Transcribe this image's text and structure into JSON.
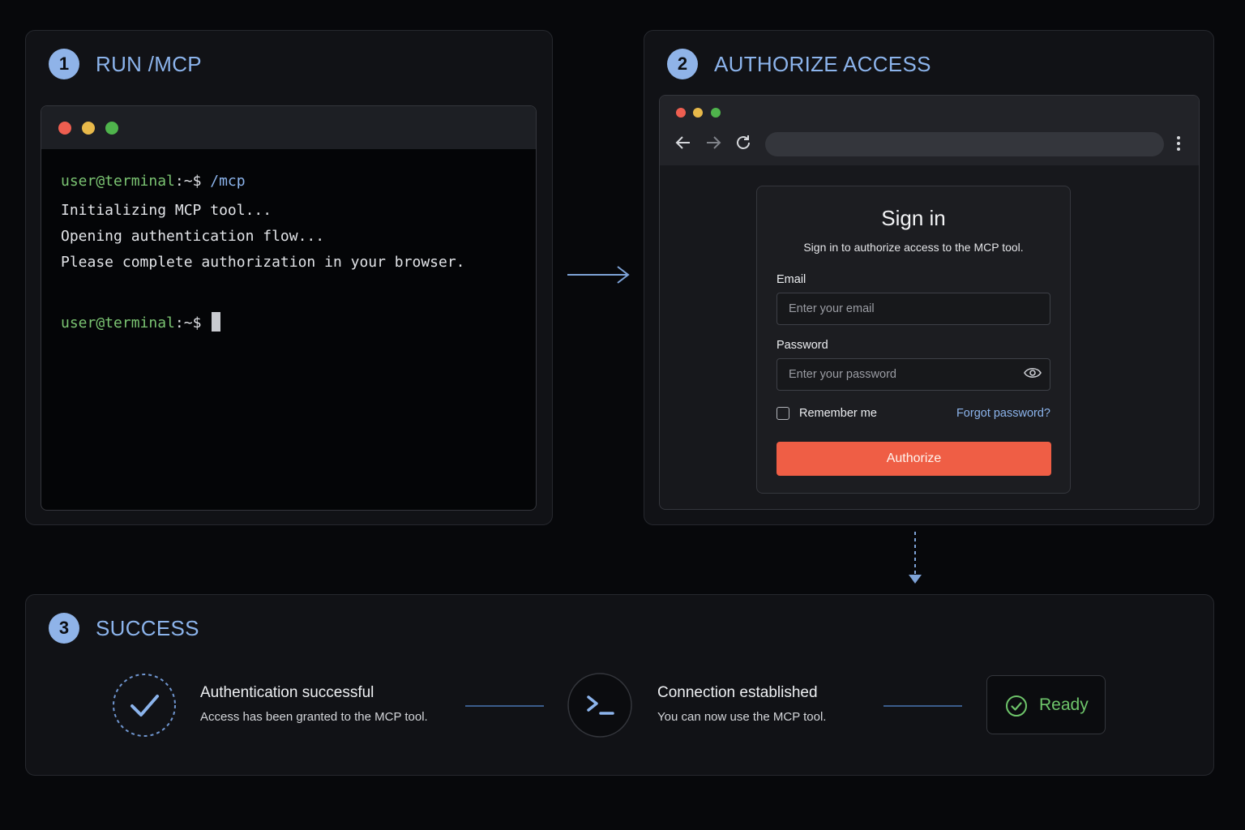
{
  "steps": {
    "run": {
      "number": "1",
      "title": "RUN /MCP"
    },
    "authorize": {
      "number": "2",
      "title": "AUTHORIZE ACCESS"
    },
    "success": {
      "number": "3",
      "title": "SUCCESS"
    }
  },
  "terminal": {
    "prompt_user": "user@terminal",
    "prompt_path": ":~$",
    "command": "/mcp",
    "output": [
      "Initializing MCP tool...",
      "Opening authentication flow...",
      "Please complete authorization in your browser."
    ]
  },
  "signin": {
    "title": "Sign in",
    "subtitle": "Sign in to authorize access to the MCP tool.",
    "email_label": "Email",
    "email_placeholder": "Enter your email",
    "password_label": "Password",
    "password_placeholder": "Enter your password",
    "remember_label": "Remember me",
    "forgot_label": "Forgot password?",
    "authorize_label": "Authorize"
  },
  "success": {
    "auth_title": "Authentication successful",
    "auth_desc": "Access has been granted to the MCP tool.",
    "conn_title": "Connection established",
    "conn_desc": "You can now use the MCP tool.",
    "ready_label": "Ready"
  },
  "colors": {
    "accent_blue": "#8cb4ec",
    "prompt_green": "#7bc472",
    "authorize_orange": "#ef5e45",
    "ready_green": "#6ec46a"
  },
  "icons": [
    "back-arrow-icon",
    "forward-arrow-icon",
    "reload-icon",
    "kebab-menu-icon",
    "eye-icon",
    "checkmark-icon",
    "terminal-prompt-icon",
    "check-circle-icon"
  ]
}
